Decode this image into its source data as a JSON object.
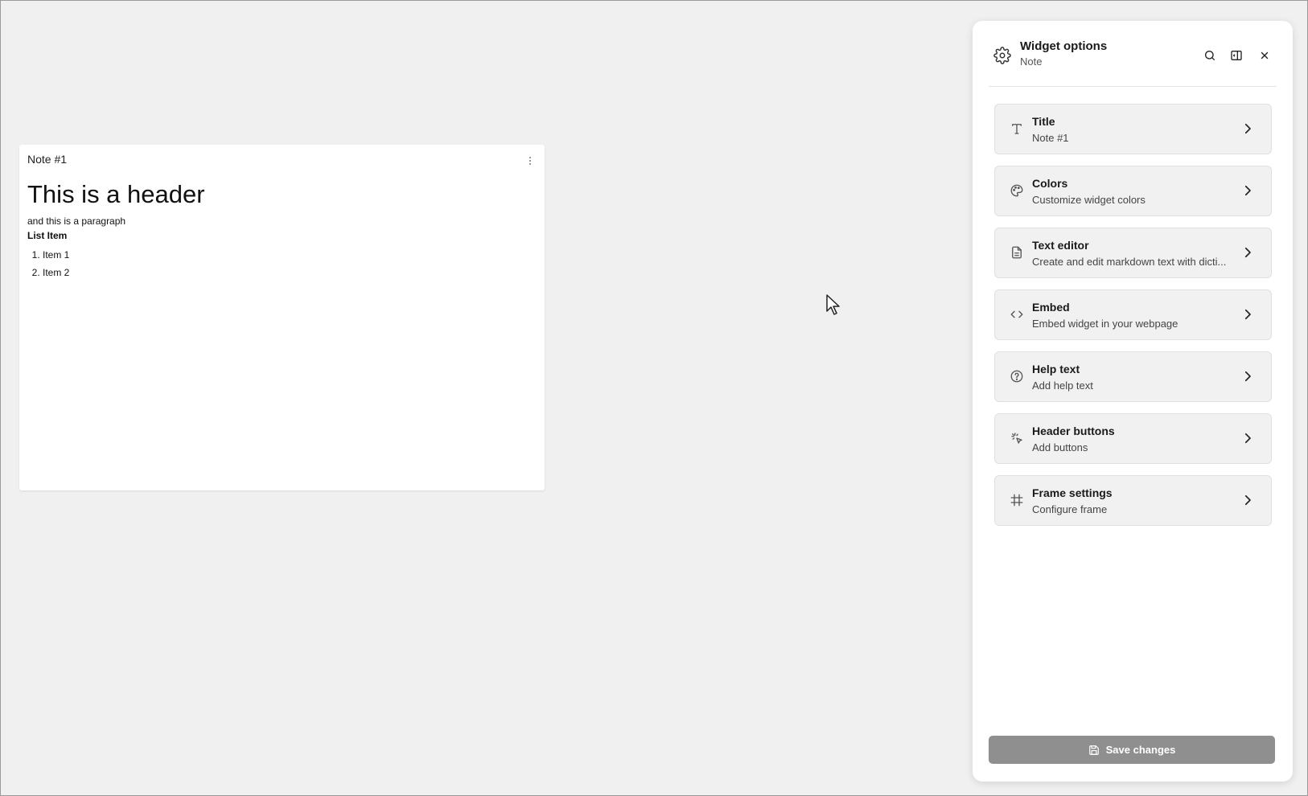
{
  "note": {
    "title": "Note #1",
    "header": "This is a header",
    "paragraph": "and this is a paragraph",
    "list_heading": "List Item",
    "list_items": [
      "Item 1",
      "Item 2"
    ]
  },
  "panel": {
    "title": "Widget options",
    "subtitle": "Note",
    "options": [
      {
        "label": "Title",
        "description": "Note #1",
        "icon": "text-icon"
      },
      {
        "label": "Colors",
        "description": "Customize widget colors",
        "icon": "palette-icon"
      },
      {
        "label": "Text editor",
        "description": "Create and edit markdown text with dicti...",
        "icon": "document-icon"
      },
      {
        "label": "Embed",
        "description": "Embed widget in your webpage",
        "icon": "code-icon"
      },
      {
        "label": "Help text",
        "description": "Add help text",
        "icon": "help-circle-icon"
      },
      {
        "label": "Header buttons",
        "description": "Add buttons",
        "icon": "pointer-click-icon"
      },
      {
        "label": "Frame settings",
        "description": "Configure frame",
        "icon": "frame-icon"
      }
    ],
    "save_label": "Save changes"
  },
  "colors": {
    "background": "#f0f0f0",
    "panel": "#ffffff",
    "option_bg": "#f1f1f1",
    "save_button": "#8f8f8f"
  }
}
